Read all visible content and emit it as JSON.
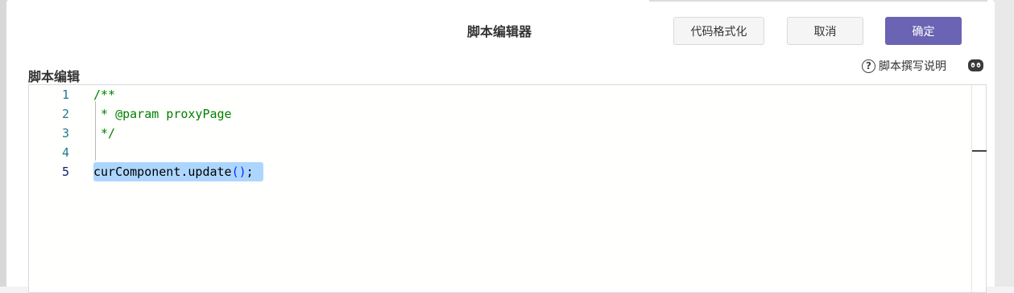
{
  "dialog": {
    "title": "脚本编辑器",
    "buttons": {
      "format_label": "代码格式化",
      "cancel_label": "取消",
      "ok_label": "确定"
    },
    "accent_color": "#6b63b3"
  },
  "editor_section": {
    "label": "脚本编辑",
    "help_label": "脚本撰写说明",
    "help_icon": "question-circle-icon",
    "assistant_icon": "robot-icon"
  },
  "code": {
    "line_numbers": [
      "1",
      "2",
      "3",
      "4",
      "5"
    ],
    "lines": [
      "/**",
      " * @param proxyPage",
      " */",
      "",
      "curComponent.update();"
    ],
    "line5_parts": {
      "prefix": "curComponent.update",
      "open": "(",
      "close": ")",
      "suffix": ";"
    },
    "active_line": "5",
    "selected_text": "curComponent.update();"
  }
}
